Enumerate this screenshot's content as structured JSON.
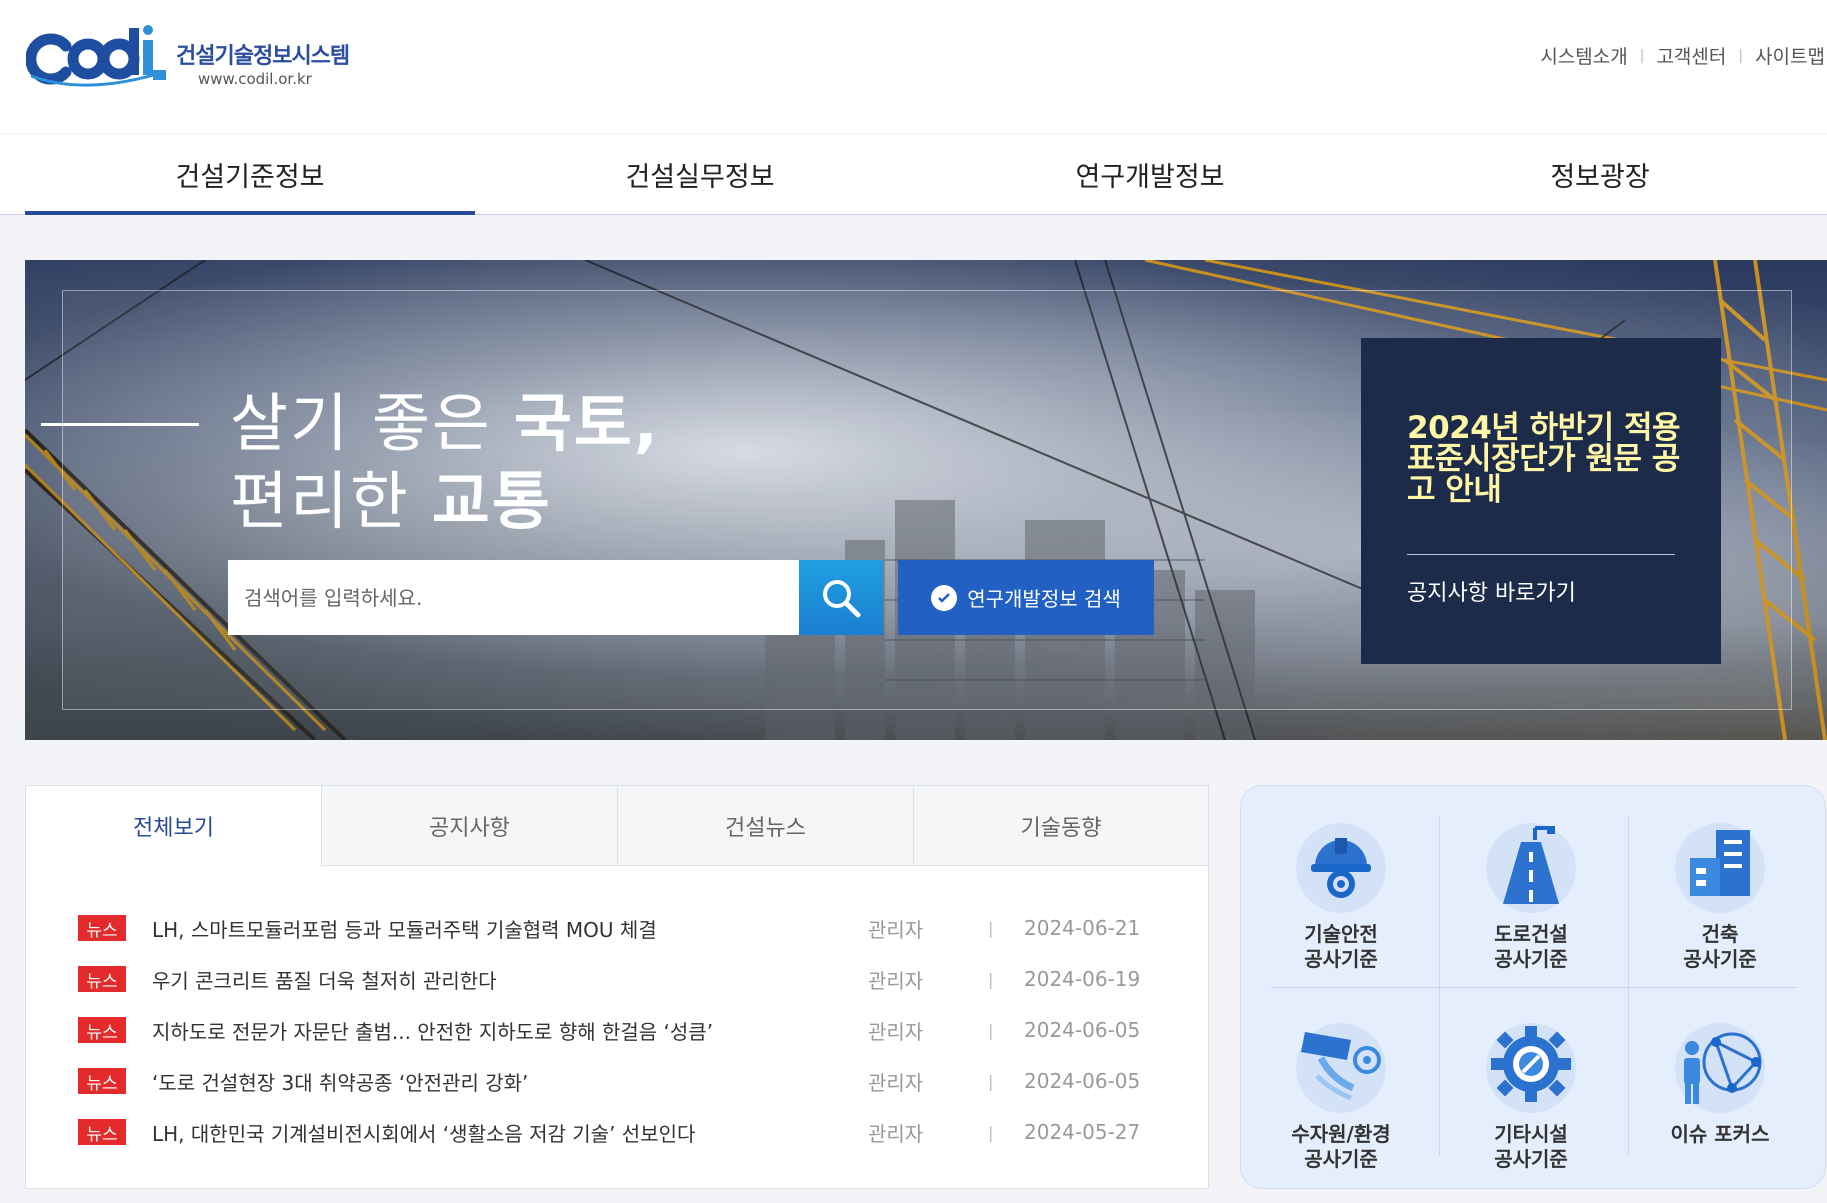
{
  "header": {
    "logo_text": "cdil",
    "site_title": "건설기술정보시스템",
    "site_url": "www.codil.or.kr",
    "utility_links": [
      "시스템소개",
      "고객센터",
      "사이트맵"
    ]
  },
  "gnb": {
    "items": [
      "건설기준정보",
      "건설실무정보",
      "연구개발정보",
      "정보광장"
    ]
  },
  "hero": {
    "title_line1_light": "살기 좋은 ",
    "title_line1_bold": "국토,",
    "title_line2_light": "편리한 ",
    "title_line2_bold": "교통",
    "search_placeholder": "검색어를 입력하세요.",
    "rnd_search_label": "연구개발정보 검색",
    "notice_title": "2024년 하반기 적용 표준시장단가 원문 공고 안내",
    "notice_link": "공지사항 바로가기"
  },
  "tabs": {
    "items": [
      "전체보기",
      "공지사항",
      "건설뉴스",
      "기술동향"
    ]
  },
  "news": [
    {
      "badge": "뉴스",
      "title": "LH, 스마트모듈러포럼 등과 모듈러주택 기술협력 MOU 체결",
      "author": "관리자",
      "sep": "|",
      "date": "2024-06-21"
    },
    {
      "badge": "뉴스",
      "title": "우기 콘크리트 품질 더욱 철저히 관리한다",
      "author": "관리자",
      "sep": "|",
      "date": "2024-06-19"
    },
    {
      "badge": "뉴스",
      "title": "지하도로 전문가 자문단 출범... 안전한 지하도로 향해 한걸음 ‘성큼’",
      "author": "관리자",
      "sep": "|",
      "date": "2024-06-05"
    },
    {
      "badge": "뉴스",
      "title": "‘도로 건설현장 3대 취약공종 ‘안전관리 강화’",
      "author": "관리자",
      "sep": "|",
      "date": "2024-06-05"
    },
    {
      "badge": "뉴스",
      "title": "LH, 대한민국 기계설비전시회에서 ‘생활소음 저감 기술’ 선보인다",
      "author": "관리자",
      "sep": "|",
      "date": "2024-05-27"
    }
  ],
  "quick_links": [
    {
      "label1": "기술안전",
      "label2": "공사기준",
      "icon": "safety-helmet-icon"
    },
    {
      "label1": "도로건설",
      "label2": "공사기준",
      "icon": "road-icon"
    },
    {
      "label1": "건축",
      "label2": "공사기준",
      "icon": "building-icon"
    },
    {
      "label1": "수자원/환경",
      "label2": "공사기준",
      "icon": "water-pipe-icon"
    },
    {
      "label1": "기타시설",
      "label2": "공사기준",
      "icon": "gear-icon"
    },
    {
      "label1": "이슈 포커스",
      "label2": "",
      "icon": "network-person-icon"
    }
  ],
  "colors": {
    "primary": "#284a9a",
    "search_btn": "#1b8fd8",
    "rnd_btn": "#2260c4",
    "notice_bg": "#1d2b4a",
    "notice_title": "#fff6a6",
    "badge": "#e42b2b",
    "quick_bg": "#e5eefc"
  }
}
